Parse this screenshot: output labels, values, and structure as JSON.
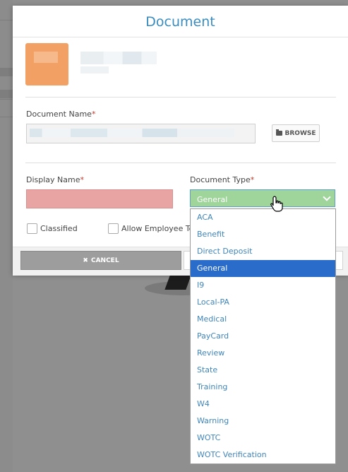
{
  "modal": {
    "title": "Document"
  },
  "form": {
    "document_name_label": "Document Name",
    "required_mark": "*",
    "browse_label": "BROWSE",
    "display_name_label": "Display Name",
    "document_type_label": "Document Type",
    "document_type_value": "General",
    "classified_label": "Classified",
    "allow_employee_label": "Allow Employee To"
  },
  "footer": {
    "cancel_label": "CANCEL"
  },
  "dropdown": {
    "options": [
      "ACA",
      "Benefit",
      "Direct Deposit",
      "General",
      "I9",
      "Local-PA",
      "Medical",
      "PayCard",
      "Review",
      "State",
      "Training",
      "W4",
      "Warning",
      "WOTC",
      "WOTC Verification"
    ],
    "selected": "General"
  },
  "colors": {
    "title": "#3a8dc0",
    "avatar": "#f2a064",
    "error_field": "#e8a3a3",
    "valid_field": "#9fd49a",
    "selected_option": "#2a6cc9",
    "option_text": "#3e86bd"
  },
  "icons": [
    "folder-icon",
    "close-icon",
    "chevron-down-icon",
    "hand-cursor-icon"
  ]
}
